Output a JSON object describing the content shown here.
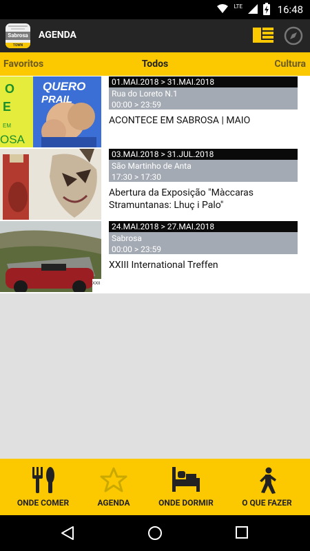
{
  "status_bar": {
    "time": "16:48",
    "network": "LTE"
  },
  "app_bar": {
    "logo_text": "Sabrosa",
    "logo_footer": "TOWN",
    "title": "AGENDA"
  },
  "tabs": {
    "left": "Favoritos",
    "center": "Todos",
    "right": "Cultura"
  },
  "events": [
    {
      "dates": "01.MAI.2018 > 31.MAI.2018",
      "place": "Rua do Loreto N.1",
      "time": "00:00 > 23:59",
      "title": "ACONTECE EM SABROSA | MAIO",
      "thumb_text": {
        "left_1": "O",
        "left_2": "E",
        "left_3": "EM",
        "left_4": "OSA",
        "banner_1": "QUERO",
        "banner_2": "PRAIL"
      }
    },
    {
      "dates": "03.MAI.2018 > 31.JUL.2018",
      "place": "São Martinho de Anta",
      "time": "17:30 > 17:30",
      "title": "Abertura da Exposição \"Màccaras Stramuntanas: Lhuç i Palo\""
    },
    {
      "dates": "24.MAI.2018 > 27.MAI.2018",
      "place": "Sabrosa",
      "time": "00:00 > 23:59",
      "title": "XXIII International Treffen",
      "thumb_text": {
        "corner": "XXII"
      }
    }
  ],
  "bottom_nav": [
    {
      "label": "ONDE COMER",
      "icon": "fork-knife-icon"
    },
    {
      "label": "AGENDA",
      "icon": "star-icon"
    },
    {
      "label": "ONDE DORMIR",
      "icon": "bed-icon"
    },
    {
      "label": "O QUE FAZER",
      "icon": "walking-person-icon"
    }
  ],
  "colors": {
    "accent": "#fcc800",
    "app_bar": "#252525",
    "date_bar": "#0a0a0a",
    "place_bar": "#a4aab4"
  }
}
